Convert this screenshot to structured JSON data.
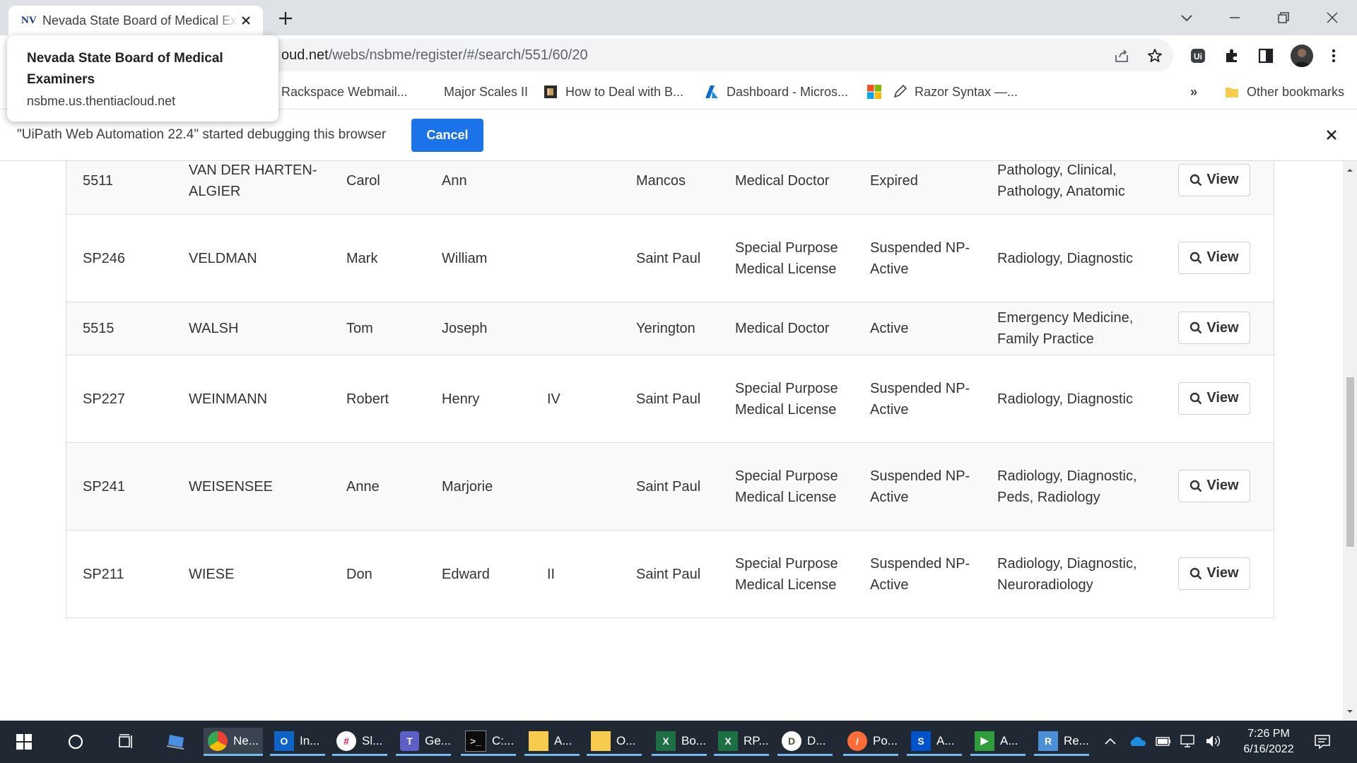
{
  "tab": {
    "favicon_text": "NV",
    "title": "Nevada State Board of Medical Examiners"
  },
  "window": {
    "new_tab": "+",
    "controls": [
      "tab-search",
      "minimize",
      "restore",
      "close"
    ]
  },
  "address_bar": {
    "url_visible": "oud.net/webs/nsbme/register/#/search/551/60/20",
    "url_dark_part": "oud.net"
  },
  "tooltip": {
    "title": "Nevada State Board of Medical Examiners",
    "host": "nsbme.us.thentiacloud.net"
  },
  "bookmarks": {
    "items": [
      {
        "label": "Rackspace Webmail..."
      },
      {
        "label": "Major Scales II"
      },
      {
        "label": "How to Deal with B..."
      },
      {
        "label": "Dashboard - Micros..."
      },
      {
        "label": "Razor Syntax —..."
      }
    ],
    "overflow": "»",
    "other": "Other bookmarks"
  },
  "infobar": {
    "message": "\"UiPath Web Automation 22.4\" started debugging this browser",
    "cancel_label": "Cancel"
  },
  "table": {
    "view_label": "View",
    "rows": [
      {
        "license": "5511",
        "last": "VAN DER HARTEN-ALGIER",
        "first": "Carol",
        "middle": "Ann",
        "suffix": "",
        "city": "Mancos",
        "type": "Medical Doctor",
        "status": "Expired",
        "specialty": "Pathology, Clinical, Pathology, Anatomic"
      },
      {
        "license": "SP246",
        "last": "VELDMAN",
        "first": "Mark",
        "middle": "William",
        "suffix": "",
        "city": "Saint Paul",
        "type": "Special Purpose Medical License",
        "status": "Suspended NP-Active",
        "specialty": "Radiology, Diagnostic"
      },
      {
        "license": "5515",
        "last": "WALSH",
        "first": "Tom",
        "middle": "Joseph",
        "suffix": "",
        "city": "Yerington",
        "type": "Medical Doctor",
        "status": "Active",
        "specialty": "Emergency Medicine, Family Practice"
      },
      {
        "license": "SP227",
        "last": "WEINMANN",
        "first": "Robert",
        "middle": "Henry",
        "suffix": "IV",
        "city": "Saint Paul",
        "type": "Special Purpose Medical License",
        "status": "Suspended NP-Active",
        "specialty": "Radiology, Diagnostic"
      },
      {
        "license": "SP241",
        "last": "WEISENSEE",
        "first": "Anne",
        "middle": "Marjorie",
        "suffix": "",
        "city": "Saint Paul",
        "type": "Special Purpose Medical License",
        "status": "Suspended NP-Active",
        "specialty": "Radiology, Diagnostic, Peds, Radiology"
      },
      {
        "license": "SP211",
        "last": "WIESE",
        "first": "Don",
        "middle": "Edward",
        "suffix": "II",
        "city": "Saint Paul",
        "type": "Special Purpose Medical License",
        "status": "Suspended NP-Active",
        "specialty": "Radiology, Diagnostic, Neuroradiology"
      }
    ]
  },
  "taskbar": {
    "apps": [
      {
        "label": "Ne...",
        "icon": "chrome-icon"
      },
      {
        "label": "In...",
        "icon": "outlook-icon"
      },
      {
        "label": "Sl...",
        "icon": "slack-icon"
      },
      {
        "label": "Ge...",
        "icon": "teams-icon"
      },
      {
        "label": "C:...",
        "icon": "terminal-icon"
      },
      {
        "label": "A...",
        "icon": "folder-icon"
      },
      {
        "label": "O...",
        "icon": "folder-icon"
      },
      {
        "label": "Bo...",
        "icon": "excel-icon"
      },
      {
        "label": "RP...",
        "icon": "excel-icon"
      },
      {
        "label": "D...",
        "icon": "dbeaver-icon"
      },
      {
        "label": "Po...",
        "icon": "postman-icon"
      },
      {
        "label": "A...",
        "icon": "sourcetree-icon"
      },
      {
        "label": "A...",
        "icon": "player-icon"
      },
      {
        "label": "Re...",
        "icon": "remote-desktop-icon"
      }
    ],
    "time": "7:26 PM",
    "date": "6/16/2022"
  }
}
